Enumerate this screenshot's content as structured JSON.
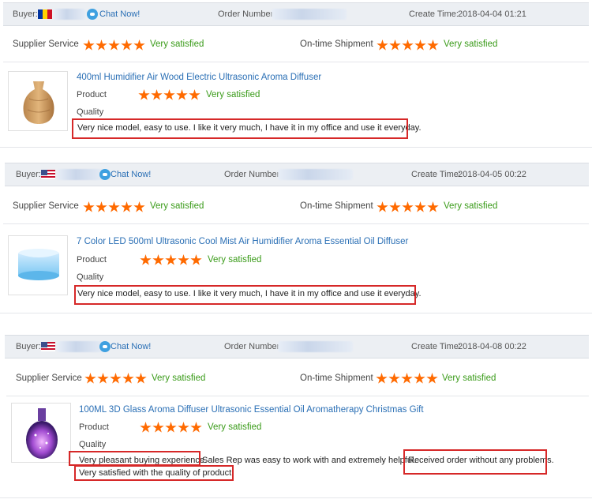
{
  "reviews": [
    {
      "buyer_label": "Buyer:",
      "chat_label": "Chat Now!",
      "order_label": "Order Number:",
      "create_label": "Create Time:",
      "create_time": "2018-04-04 01:21",
      "supplier_label": "Supplier Service",
      "supplier_rating": "Very satisfied",
      "shipment_label": "On-time Shipment",
      "shipment_rating": "Very satisfied",
      "product_title": "400ml Humidifier Air Wood Electric Ultrasonic Aroma Diffuser",
      "product_label": "Product",
      "product_rating": "Very satisfied",
      "quality_label": "Quality",
      "review_text": "Very nice model, easy to use. I like it very much, I have it in my office and use it everyday."
    },
    {
      "buyer_label": "Buyer:",
      "chat_label": "Chat Now!",
      "order_label": "Order Number:",
      "create_label": "Create Time:",
      "create_time": "2018-04-05 00:22",
      "supplier_label": "Supplier Service",
      "supplier_rating": "Very satisfied",
      "shipment_label": "On-time Shipment",
      "shipment_rating": "Very satisfied",
      "product_title": "7 Color LED 500ml Ultrasonic Cool Mist Air Humidifier Aroma Essential Oil Diffuser",
      "product_label": "Product",
      "product_rating": "Very satisfied",
      "quality_label": "Quality",
      "review_text": "Very nice model, easy to use. I like it very much, I have it in my office and use it everyday."
    },
    {
      "buyer_label": "Buyer:",
      "chat_label": "Chat Now!",
      "order_label": "Order Number:",
      "create_label": "Create Time:",
      "create_time": "2018-04-08 00:22",
      "supplier_label": "Supplier Service",
      "supplier_rating": "Very satisfied",
      "shipment_label": "On-time Shipment",
      "shipment_rating": "Very satisfied",
      "product_title": "100ML 3D Glass Aroma Diffuser Ultrasonic Essential Oil Aromatherapy Christmas Gift",
      "product_label": "Product",
      "product_rating": "Very satisfied",
      "quality_label": "Quality",
      "review_part1": "Very pleasant buying experience.",
      "review_part2": "Sales Rep was easy to work with and extremely helpful.",
      "review_part3": "Received order without any problems.",
      "review_line2": "Very satisfied with the quality of product."
    }
  ],
  "colors": {
    "star": "#ff6a00",
    "satisfied": "#3a9b19",
    "link": "#2a6fb5",
    "highlight_box": "#d62828",
    "header_bg": "#eceff3"
  },
  "icons": {
    "star": "star-icon",
    "chat": "chat-bubble-icon",
    "flag_1": "romania-flag-icon",
    "flag_2": "usa-flag-icon",
    "flag_3": "usa-flag-icon"
  },
  "ratings": {
    "stars_filled": 5,
    "stars_total": 5
  }
}
